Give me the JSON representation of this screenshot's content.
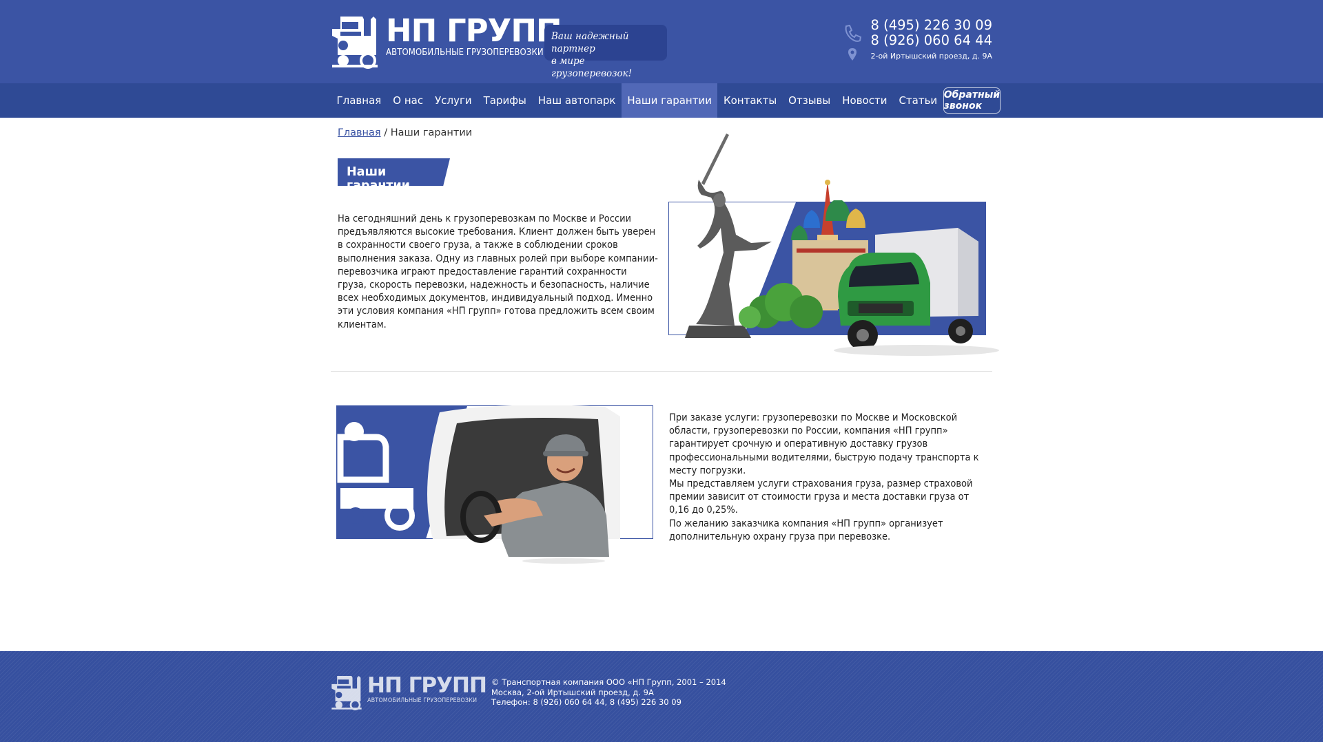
{
  "header": {
    "brand_name": "НП ГРУПП",
    "brand_sub": "АВТОМОБИЛЬНЫЕ ГРУЗОПЕРЕВОЗКИ",
    "slogan_line1": "Ваш надежный партнер",
    "slogan_line2": "в мире грузоперевозок!",
    "phone1": "8 (495) 226 30 09",
    "phone2": "8 (926) 060 64 44",
    "address": "2-ой Иртышский проезд, д. 9А"
  },
  "nav": {
    "items": [
      "Главная",
      "О нас",
      "Услуги",
      "Тарифы",
      "Наш автопарк",
      "Наши гарантии",
      "Контакты",
      "Отзывы",
      "Новости",
      "Статьи"
    ],
    "active_index": 5,
    "callback_label": "Обратный звонок"
  },
  "breadcrumb": {
    "home": "Главная",
    "separator": " / ",
    "current": "Наши гарантии"
  },
  "page": {
    "title": "Наши гарантии",
    "paragraph1": "На сегодняшний день к грузоперевозкам по Москве и России предъявляются высокие требования. Клиент должен быть уверен в сохранности своего груза, а также в соблюдении сроков выполнения заказа. Одну из главных ролей при выборе компании-перевозчика играют предоставление гарантий сохранности груза, скорость перевозки, надежность и безопасность, наличие всех необходимых документов, индивидуальный подход. Именно эти условия компания «НП групп» готова предложить всем своим клиентам.",
    "paragraph2": "При заказе услуги: грузоперевозки по Москве и Московской области, грузоперевозки по России, компания «НП групп» гарантирует срочную и оперативную доставку грузов профессиональными водителями, быструю подачу транспорта к месту погрузки.",
    "paragraph3": "Мы представляем услуги страхования груза, размер страховой премии зависит от стоимости груза и места доставки груза от 0,16 до 0,25%.",
    "paragraph4": "По желанию заказчика компания «НП групп» организует дополнительную охрану груза при перевозке."
  },
  "footer": {
    "brand_name": "НП ГРУПП",
    "brand_sub": "АВТОМОБИЛЬНЫЕ ГРУЗОПЕРЕВОЗКИ",
    "line1": "© Транспортная компания ООО «НП Групп, 2001 – 2014",
    "line2": "Москва, 2-ой Иртышский проезд, д. 9А",
    "line3": "Телефон: 8 (926) 060 64 44,  8 (495) 226 30 09"
  },
  "colors": {
    "brand_blue": "#3b54a4",
    "nav_blue": "#2f4a95",
    "nav_active": "#5168b7"
  },
  "icons": [
    "truck-logo-icon",
    "phone-icon",
    "location-pin-icon"
  ]
}
